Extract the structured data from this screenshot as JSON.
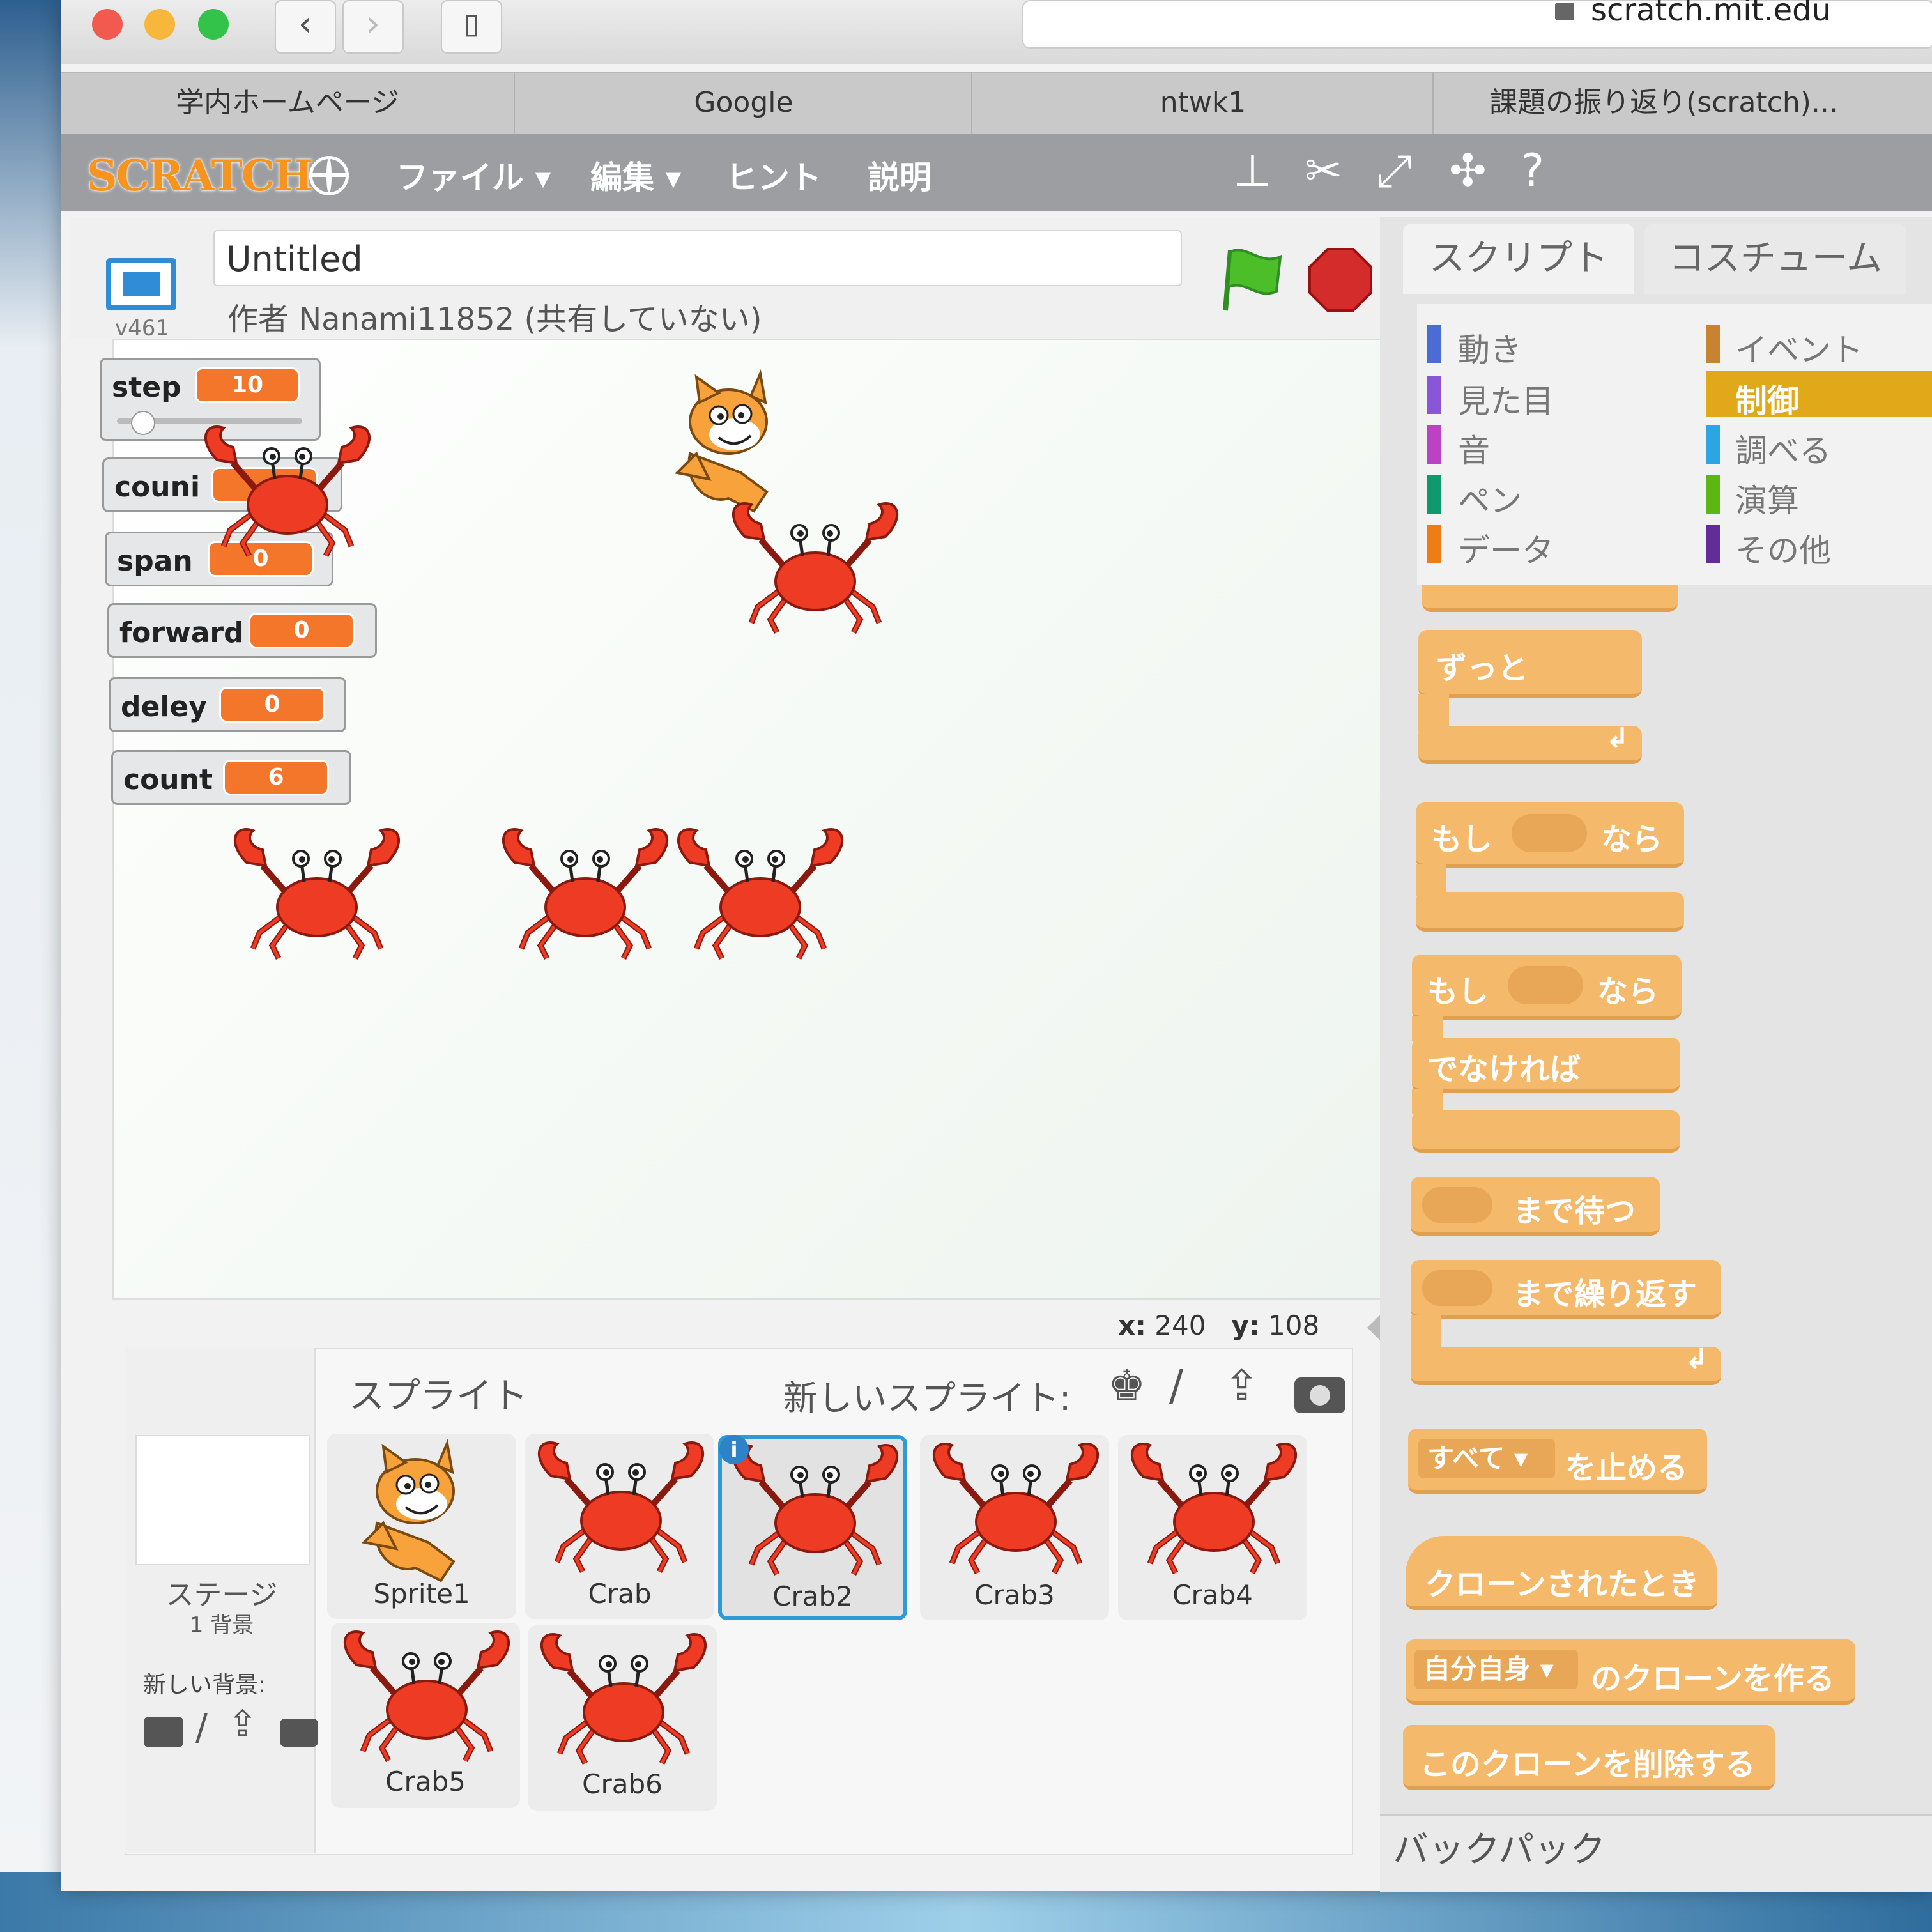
{
  "browser": {
    "url": "scratch.mit.edu",
    "tabs": [
      "学内ホームページ",
      "Google",
      "ntwk1",
      "課題の振り返り(scratch)..."
    ]
  },
  "menubar": {
    "logo": "SCRATCH",
    "items": [
      "ファイル ▾",
      "編集 ▾",
      "ヒント",
      "説明"
    ]
  },
  "project": {
    "title": "Untitled",
    "author": "作者 Nanami11852 (共有していない)",
    "version": "v461"
  },
  "monitors": [
    {
      "label": "step",
      "value": "10"
    },
    {
      "label": "couni",
      "value": ""
    },
    {
      "label": "span",
      "value": "0"
    },
    {
      "label": "forward",
      "value": "0"
    },
    {
      "label": "deley",
      "value": "0"
    },
    {
      "label": "count",
      "value": "6"
    }
  ],
  "coords": {
    "x_label": "x:",
    "x": "240",
    "y_label": "y:",
    "y": "108"
  },
  "sprites_pane": {
    "title": "スプライト",
    "new_sprite": "新しいスプライト:",
    "stage_label": "ステージ",
    "stage_sub": "1 背景",
    "new_backdrop": "新しい背景:",
    "sprites": [
      "Sprite1",
      "Crab",
      "Crab2",
      "Crab3",
      "Crab4",
      "Crab5",
      "Crab6"
    ],
    "selected": "Crab2"
  },
  "palette": {
    "tabs": [
      "スクリプト",
      "コスチューム"
    ],
    "categories_left": [
      "動き",
      "見た目",
      "音",
      "ペン",
      "データ"
    ],
    "categories_right": [
      "イベント",
      "制御",
      "調べる",
      "演算",
      "その他"
    ],
    "selected_category": "制御",
    "colors": {
      "motion": "#4a6cd4",
      "looks": "#8a55d7",
      "sound": "#bb42c3",
      "pen": "#0e9a6c",
      "data": "#ee7d16",
      "events": "#c88330",
      "control": "#e1a91a",
      "sensing": "#2ca5e2",
      "operators": "#5cb712",
      "more": "#632d99"
    },
    "blocks": {
      "forever": "ずっと",
      "if_prefix": "もし",
      "if_suffix": "なら",
      "else": "でなければ",
      "wait_until": "まで待つ",
      "repeat_until": "まで繰り返す",
      "stop_option": "すべて ▾",
      "stop": "を止める",
      "when_clone": "クローンされたとき",
      "clone_option": "自分自身 ▾",
      "create_clone": "のクローンを作る",
      "delete_clone": "このクローンを削除する"
    },
    "backpack": "バックパック"
  }
}
